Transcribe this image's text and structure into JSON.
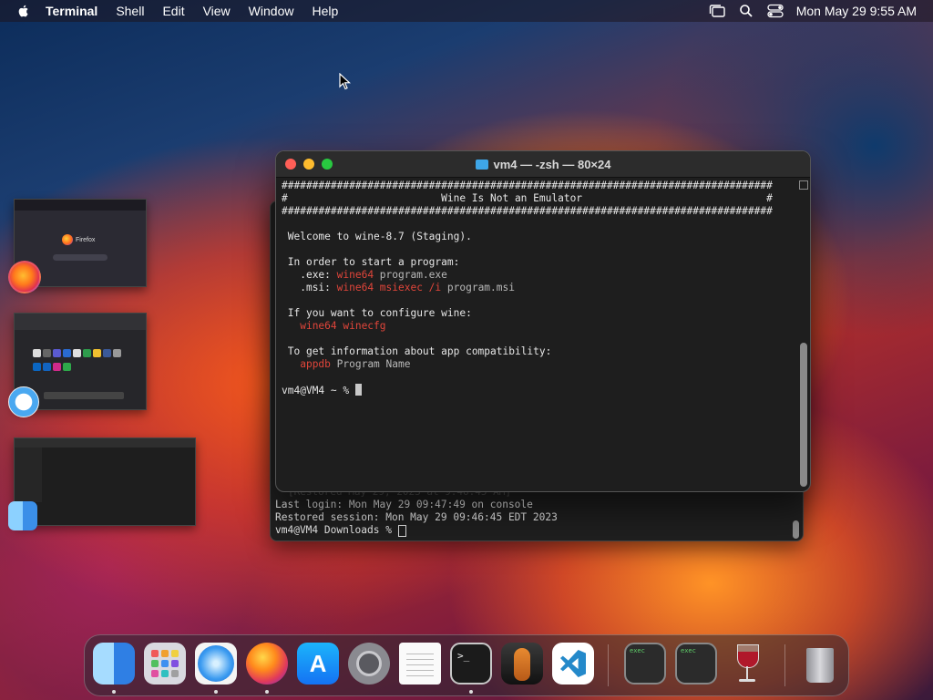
{
  "menubar": {
    "app_name": "Terminal",
    "items": [
      "Shell",
      "Edit",
      "View",
      "Window",
      "Help"
    ],
    "clock": "Mon May 29  9:55 AM"
  },
  "front_terminal": {
    "title": "vm4 — -zsh — 80×24",
    "lines": {
      "hash1": "################################################################################",
      "banner": "#                         Wine Is Not an Emulator                              #",
      "hash2": "################################################################################",
      "welcome": "Welcome to wine-8.7 (Staging).",
      "start_intro": "In order to start a program:",
      "exe_label": "  .exe: ",
      "exe_cmd": "wine64",
      "exe_arg": " program.exe",
      "msi_label": "  .msi: ",
      "msi_cmd": "wine64 msiexec /i",
      "msi_arg": " program.msi",
      "config_intro": "If you want to configure wine:",
      "config_cmd": "  wine64 winecfg",
      "compat_intro": "To get information about app compatibility:",
      "compat_cmd": "  appdb",
      "compat_arg": " Program Name",
      "prompt": "vm4@VM4 ~ % "
    }
  },
  "back_terminal": {
    "faded_line": "[Restored May 29, 2023 at 9:46:45 AM]",
    "last_login": "Last login: Mon May 29 09:47:49 on console",
    "restored": "Restored session: Mon May 29 09:46:45 EDT 2023",
    "prompt": "vm4@VM4 Downloads % "
  },
  "stage_manager": {
    "firefox_thumb_label": "Firefox"
  },
  "dock": {
    "items": [
      "Finder",
      "Launchpad",
      "Safari",
      "Firefox",
      "App Store",
      "System Settings",
      "TextEdit",
      "Terminal",
      "GarageBand",
      "Visual Studio Code",
      "exec",
      "exec",
      "Wine",
      "Trash"
    ],
    "exec_label": "exec",
    "terminal_glyph": ">_"
  },
  "colors": {
    "terminal_red": "#e0453a",
    "traffic_red": "#ff5f57",
    "traffic_yellow": "#febc2e",
    "traffic_green": "#28c840"
  }
}
